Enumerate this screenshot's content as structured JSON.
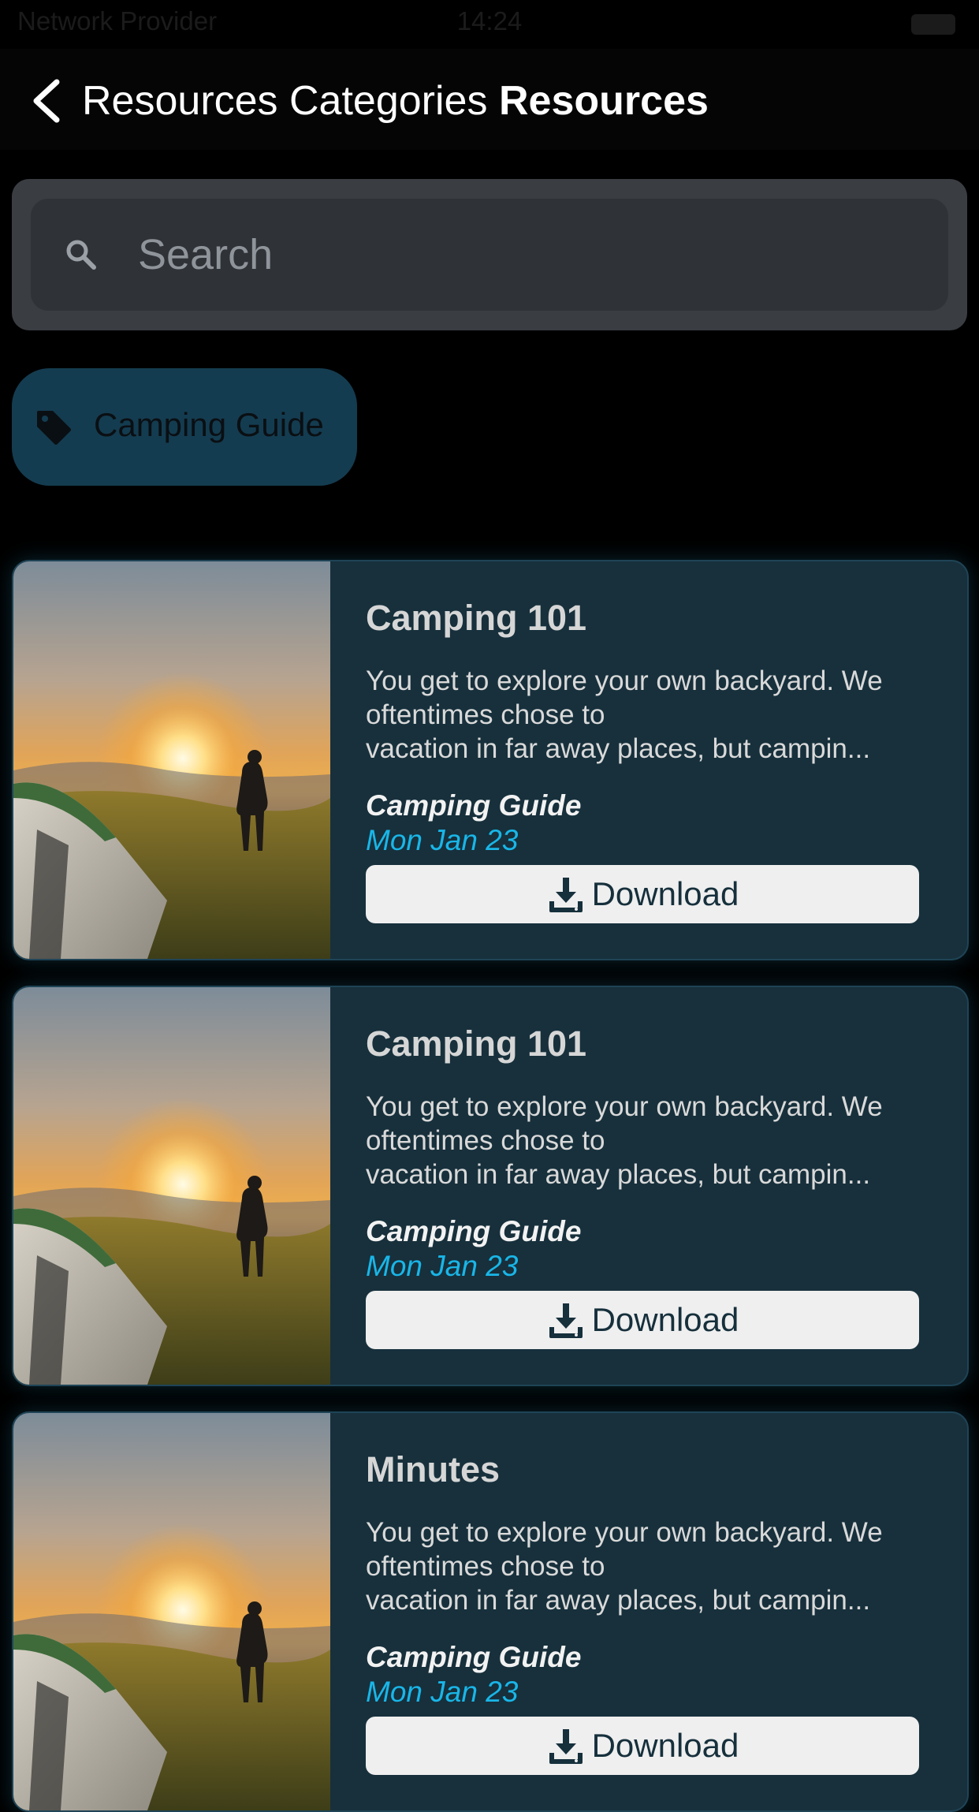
{
  "status_bar": {
    "carrier": "Network Provider",
    "time": "14:24"
  },
  "nav": {
    "back_label": "Resources Categories",
    "title": "Resources"
  },
  "search": {
    "placeholder": "Search",
    "value": ""
  },
  "filter_chip": {
    "label": "Camping Guide",
    "icon": "tag-icon"
  },
  "cards": [
    {
      "title": "Camping 101",
      "description_lines": [
        "You get to explore your own backyard. We",
        "oftentimes chose to",
        "vacation in far away places, but campin..."
      ],
      "category": "Camping Guide",
      "date": "Mon Jan 23",
      "button_label": "Download"
    },
    {
      "title": "Camping 101",
      "description_lines": [
        "You get to explore your own backyard. We",
        "oftentimes chose to",
        "vacation in far away places, but campin..."
      ],
      "category": "Camping Guide",
      "date": "Mon Jan 23",
      "button_label": "Download"
    },
    {
      "title": "Minutes",
      "description_lines": [
        "You get to explore your own backyard. We",
        "oftentimes chose to",
        "vacation in far away places, but campin..."
      ],
      "category": "Camping Guide",
      "date": "Mon Jan 23",
      "button_label": "Download"
    }
  ],
  "colors": {
    "background": "#000000",
    "card_background": "#17303c",
    "chip_background": "#143c50",
    "date_accent": "#19b6e8",
    "button_background": "#efefef"
  }
}
